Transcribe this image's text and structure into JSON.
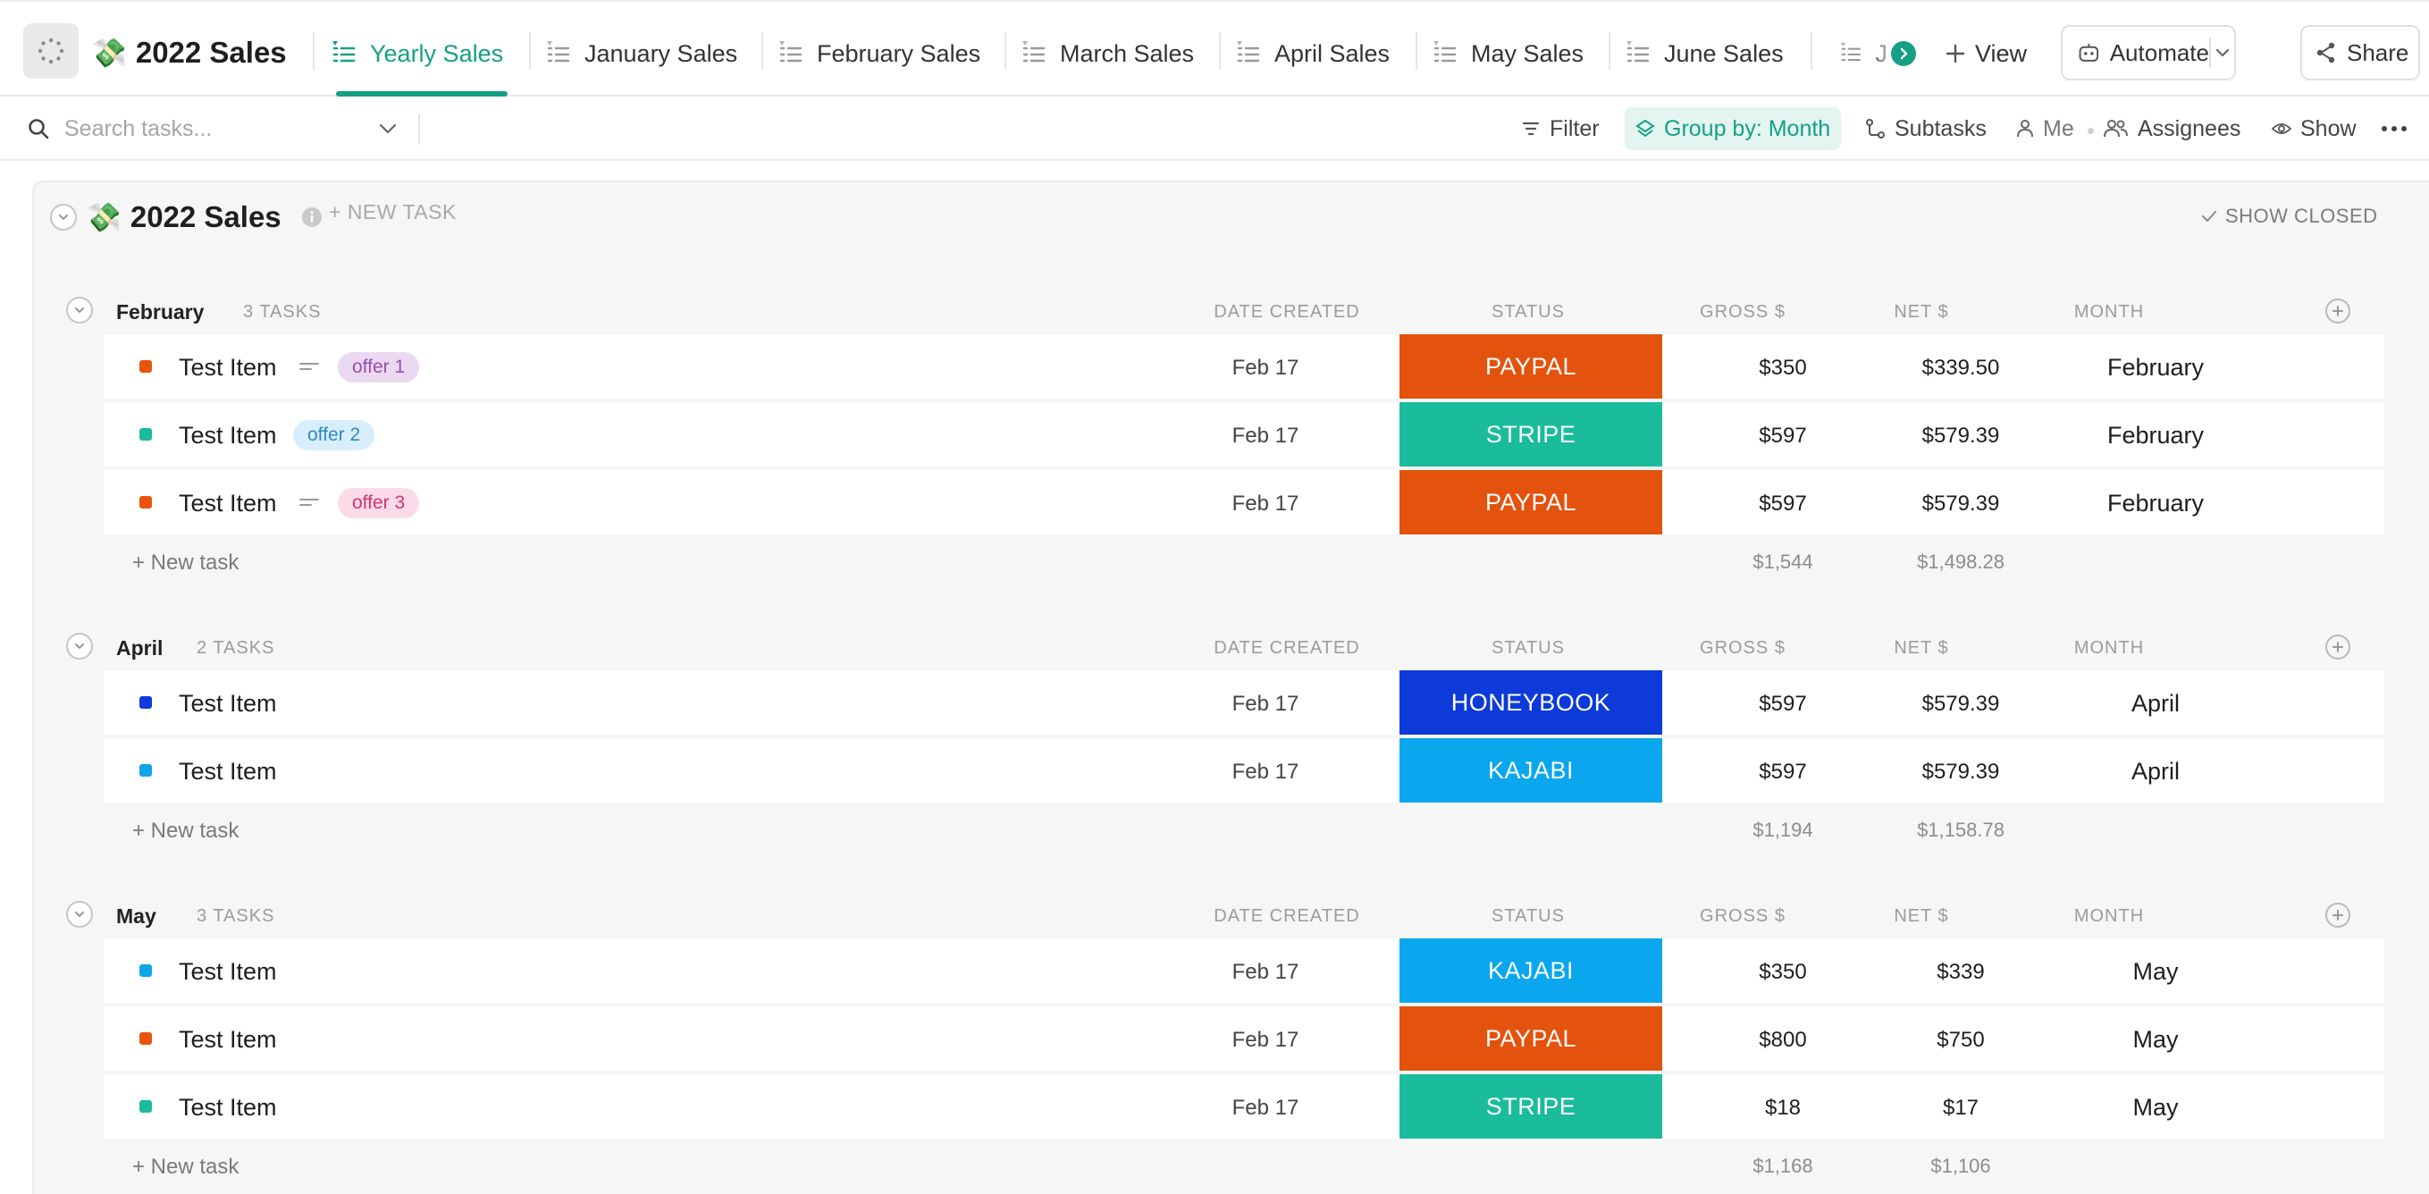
{
  "header": {
    "title": "2022 Sales",
    "title_emoji": "💸",
    "tabs": [
      {
        "label": "Yearly Sales",
        "active": true
      },
      {
        "label": "January Sales",
        "active": false
      },
      {
        "label": "February Sales",
        "active": false
      },
      {
        "label": "March Sales",
        "active": false
      },
      {
        "label": "April Sales",
        "active": false
      },
      {
        "label": "May Sales",
        "active": false
      },
      {
        "label": "June Sales",
        "active": false
      }
    ],
    "overflow_tab_label": "J",
    "view_label": "View",
    "automate_label": "Automate",
    "share_label": "Share"
  },
  "toolbar": {
    "search_placeholder": "Search tasks...",
    "filter_label": "Filter",
    "group_by_label": "Group by: Month",
    "subtasks_label": "Subtasks",
    "me_label": "Me",
    "assignees_label": "Assignees",
    "show_label": "Show"
  },
  "list": {
    "title": "2022 Sales",
    "emoji": "💸",
    "new_task_label": "+ NEW TASK",
    "show_closed_label": "SHOW CLOSED"
  },
  "columns": {
    "date_created": "DATE CREATED",
    "status": "STATUS",
    "gross": "GROSS $",
    "net": "NET $",
    "month": "MONTH"
  },
  "new_task_row_label": "+ New task",
  "groups": [
    {
      "name": "February",
      "count": "3 TASKS",
      "rows": [
        {
          "name": "Test Item",
          "color": "#e8540c",
          "has_desc": true,
          "tag": "offer 1",
          "tag_bg": "#ead9f0",
          "tag_fg": "#9a4db3",
          "date": "Feb 17",
          "status": "PAYPAL",
          "status_color": "#e3530d",
          "gross": "$350",
          "net": "$339.50",
          "month": "February"
        },
        {
          "name": "Test Item",
          "color": "#1bbc9b",
          "has_desc": false,
          "tag": "offer 2",
          "tag_bg": "#d9eefb",
          "tag_fg": "#2a8ac7",
          "date": "Feb 17",
          "status": "STRIPE",
          "status_color": "#1bbc9b",
          "gross": "$597",
          "net": "$579.39",
          "month": "February"
        },
        {
          "name": "Test Item",
          "color": "#e8540c",
          "has_desc": true,
          "tag": "offer 3",
          "tag_bg": "#fbdbe7",
          "tag_fg": "#d6336c",
          "date": "Feb 17",
          "status": "PAYPAL",
          "status_color": "#e3530d",
          "gross": "$597",
          "net": "$579.39",
          "month": "February"
        }
      ],
      "sum_gross": "$1,544",
      "sum_net": "$1,498.28"
    },
    {
      "name": "April",
      "count": "2 TASKS",
      "rows": [
        {
          "name": "Test Item",
          "color": "#0f3bdb",
          "has_desc": false,
          "tag": "",
          "date": "Feb 17",
          "status": "HONEYBOOK",
          "status_color": "#0d3ad8",
          "gross": "$597",
          "net": "$579.39",
          "month": "April"
        },
        {
          "name": "Test Item",
          "color": "#0ea5e9",
          "has_desc": false,
          "tag": "",
          "date": "Feb 17",
          "status": "KAJABI",
          "status_color": "#0aa7ee",
          "gross": "$597",
          "net": "$579.39",
          "month": "April"
        }
      ],
      "sum_gross": "$1,194",
      "sum_net": "$1,158.78"
    },
    {
      "name": "May",
      "count": "3 TASKS",
      "rows": [
        {
          "name": "Test Item",
          "color": "#0ea5e9",
          "has_desc": false,
          "tag": "",
          "date": "Feb 17",
          "status": "KAJABI",
          "status_color": "#0aa7ee",
          "gross": "$350",
          "net": "$339",
          "month": "May"
        },
        {
          "name": "Test Item",
          "color": "#e8540c",
          "has_desc": false,
          "tag": "",
          "date": "Feb 17",
          "status": "PAYPAL",
          "status_color": "#e3530d",
          "gross": "$800",
          "net": "$750",
          "month": "May"
        },
        {
          "name": "Test Item",
          "color": "#1bbc9b",
          "has_desc": false,
          "tag": "",
          "date": "Feb 17",
          "status": "STRIPE",
          "status_color": "#1bbc9b",
          "gross": "$18",
          "net": "$17",
          "month": "May"
        }
      ],
      "sum_gross": "$1,168",
      "sum_net": "$1,106"
    }
  ],
  "icons": {
    "space": "loading-dots-icon",
    "list_view": "list-view-icon",
    "plus": "plus-icon",
    "automate": "robot-icon",
    "share": "share-icon",
    "search": "search-icon",
    "filter": "filter-icon",
    "group": "layers-icon",
    "subtasks": "subtasks-icon",
    "me": "person-icon",
    "assignees": "people-icon",
    "show": "eye-icon",
    "more": "more-horizontal-icon",
    "info": "info-icon",
    "check": "check-icon"
  }
}
